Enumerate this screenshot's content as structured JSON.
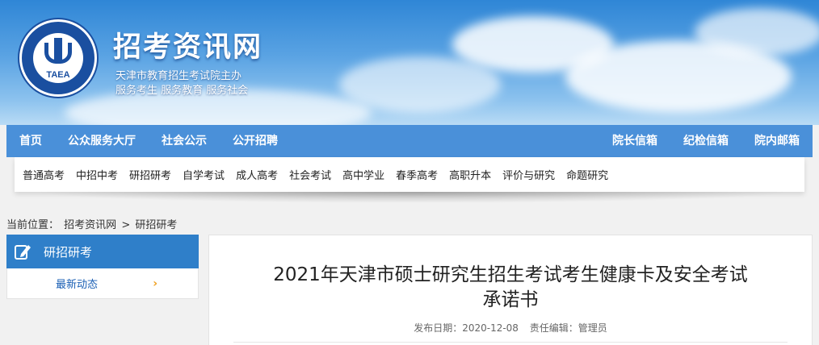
{
  "header": {
    "site_title": "招考资讯网",
    "subtitle_1": "天津市教育招生考试院主办",
    "subtitle_2": "服务考生 服务教育 服务社会",
    "logo_text": "TAEA"
  },
  "main_nav": {
    "left": [
      "首页",
      "公众服务大厅",
      "社会公示",
      "公开招聘"
    ],
    "right": [
      "院长信箱",
      "纪检信箱",
      "院内邮箱"
    ],
    "background": "#4a90d9"
  },
  "sub_nav": [
    "普通高考",
    "中招中考",
    "研招研考",
    "自学考试",
    "成人高考",
    "社会考试",
    "高中学业",
    "春季高考",
    "高职升本",
    "评价与研究",
    "命题研究"
  ],
  "breadcrumb": {
    "prefix": "当前位置：",
    "items": [
      "招考资讯网",
      "研招研考"
    ],
    "separator": ">"
  },
  "sidebar": {
    "heading": "研招研考",
    "heading_icon": "edit-icon",
    "items": [
      {
        "label": "最新动态"
      }
    ],
    "accent": "#2f7fc9"
  },
  "article": {
    "title_line1": "2021年天津市硕士研究生招生考试考生健康卡及安全考试",
    "title_line2": "承诺书",
    "publish_label": "发布日期：",
    "publish_date": "2020-12-08",
    "editor_label": "责任编辑：",
    "editor": "管理员"
  }
}
